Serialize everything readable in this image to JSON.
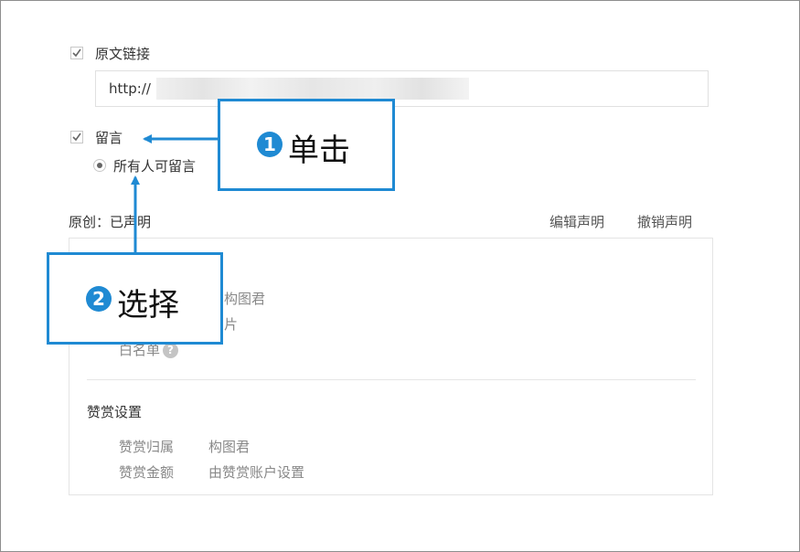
{
  "original_link": {
    "checkbox_label": "原文链接",
    "url_value": "http://"
  },
  "comments": {
    "checkbox_label": "留言",
    "radio_label": "所有人可留言"
  },
  "original": {
    "status_label": "原创：已声明",
    "edit_link": "编辑声明",
    "revoke_link": "撤销声明"
  },
  "declaration_panel": {
    "partial_author": "构图君",
    "partial_type": "片",
    "whitelist_label": "白名单",
    "help_icon": "?"
  },
  "reward": {
    "section_title": "赞赏设置",
    "rows": [
      {
        "key": "赞赏归属",
        "value": "构图君"
      },
      {
        "key": "赞赏金额",
        "value": "由赞赏账户设置"
      }
    ]
  },
  "callouts": [
    {
      "number": "1",
      "text": "单击"
    },
    {
      "number": "2",
      "text": "选择"
    }
  ],
  "colors": {
    "callout_blue": "#1f8ad3"
  }
}
